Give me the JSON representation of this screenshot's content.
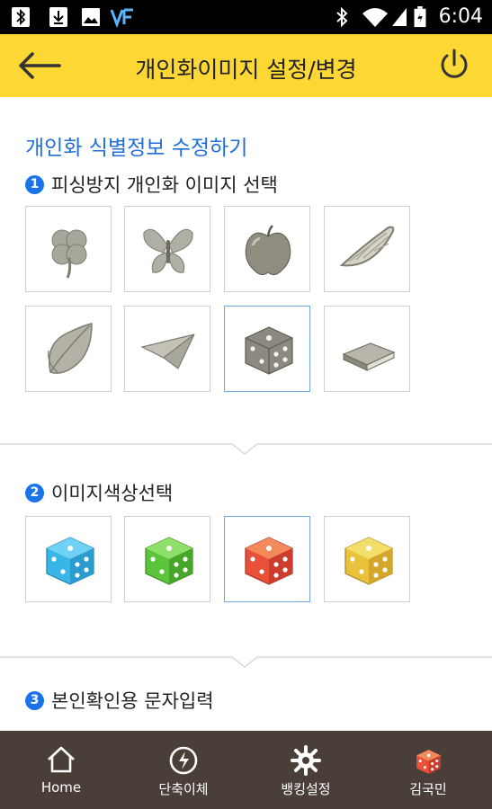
{
  "status_bar": {
    "time": "6:04"
  },
  "header": {
    "title": "개인화이미지 설정/변경"
  },
  "main": {
    "section_title": "개인화 식별정보 수정하기",
    "steps": [
      {
        "number": "1",
        "label": "피싱방지 개인화 이미지 선택"
      },
      {
        "number": "2",
        "label": "이미지색상선택"
      },
      {
        "number": "3",
        "label": "본인확인용 문자입력"
      }
    ],
    "images": [
      "clover-icon",
      "butterfly-icon",
      "apple-icon",
      "lemon-icon",
      "leaf-icon",
      "paper-plane-icon",
      "dice-icon",
      "book-icon"
    ],
    "selected_image": "dice-icon",
    "colors": [
      {
        "name": "blue",
        "hex": "#38b6e8"
      },
      {
        "name": "green",
        "hex": "#5cc43a"
      },
      {
        "name": "red",
        "hex": "#e8503a"
      },
      {
        "name": "yellow",
        "hex": "#e8c23a"
      }
    ],
    "selected_color": "red"
  },
  "bottom_nav": {
    "items": [
      {
        "label": "Home",
        "icon": "home-icon"
      },
      {
        "label": "단축이체",
        "icon": "quick-transfer-icon"
      },
      {
        "label": "뱅킹설정",
        "icon": "gear-icon"
      },
      {
        "label": "김국민",
        "icon": "dice-avatar-icon"
      }
    ]
  },
  "colors": {
    "header": "#fdd835",
    "accent": "#1e6fd9",
    "bottom_nav": "#4a3f38"
  }
}
